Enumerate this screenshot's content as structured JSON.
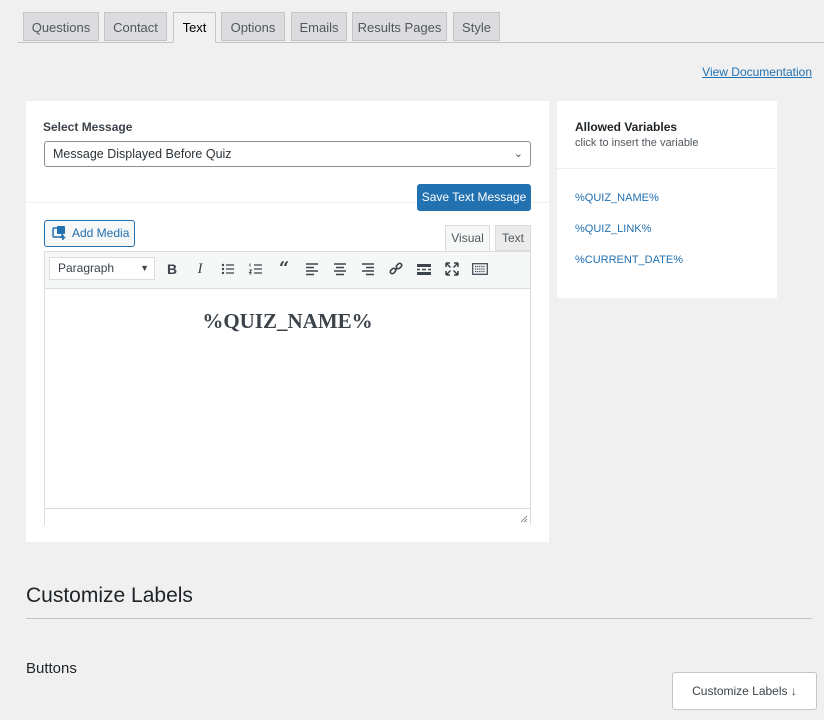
{
  "tabs": [
    {
      "label": "Questions",
      "active": false
    },
    {
      "label": "Contact",
      "active": false
    },
    {
      "label": "Text",
      "active": true
    },
    {
      "label": "Options",
      "active": false
    },
    {
      "label": "Emails",
      "active": false
    },
    {
      "label": "Results Pages",
      "active": false
    },
    {
      "label": "Style",
      "active": false
    }
  ],
  "view_documentation": "View Documentation",
  "message": {
    "label": "Select Message",
    "selected": "Message Displayed Before Quiz",
    "save_button": "Save Text Message"
  },
  "editor": {
    "add_media": "Add Media",
    "mode_visual": "Visual",
    "mode_text": "Text",
    "format_select": "Paragraph",
    "content": "%QUIZ_NAME%",
    "toolbar_icons": [
      "bold-icon",
      "italic-icon",
      "bulleted-list-icon",
      "numbered-list-icon",
      "blockquote-icon",
      "align-left-icon",
      "align-center-icon",
      "align-right-icon",
      "link-icon",
      "read-more-icon",
      "fullscreen-icon",
      "toolbar-toggle-icon"
    ]
  },
  "allowed_variables": {
    "title": "Allowed Variables",
    "subtitle": "click to insert the variable",
    "items": [
      "%QUIZ_NAME%",
      "%QUIZ_LINK%",
      "%CURRENT_DATE%"
    ]
  },
  "customize": {
    "heading": "Customize Labels",
    "subheading": "Buttons",
    "button": "Customize Labels ↓"
  },
  "colors": {
    "accent": "#2271b1",
    "background": "#f0f0f1"
  }
}
